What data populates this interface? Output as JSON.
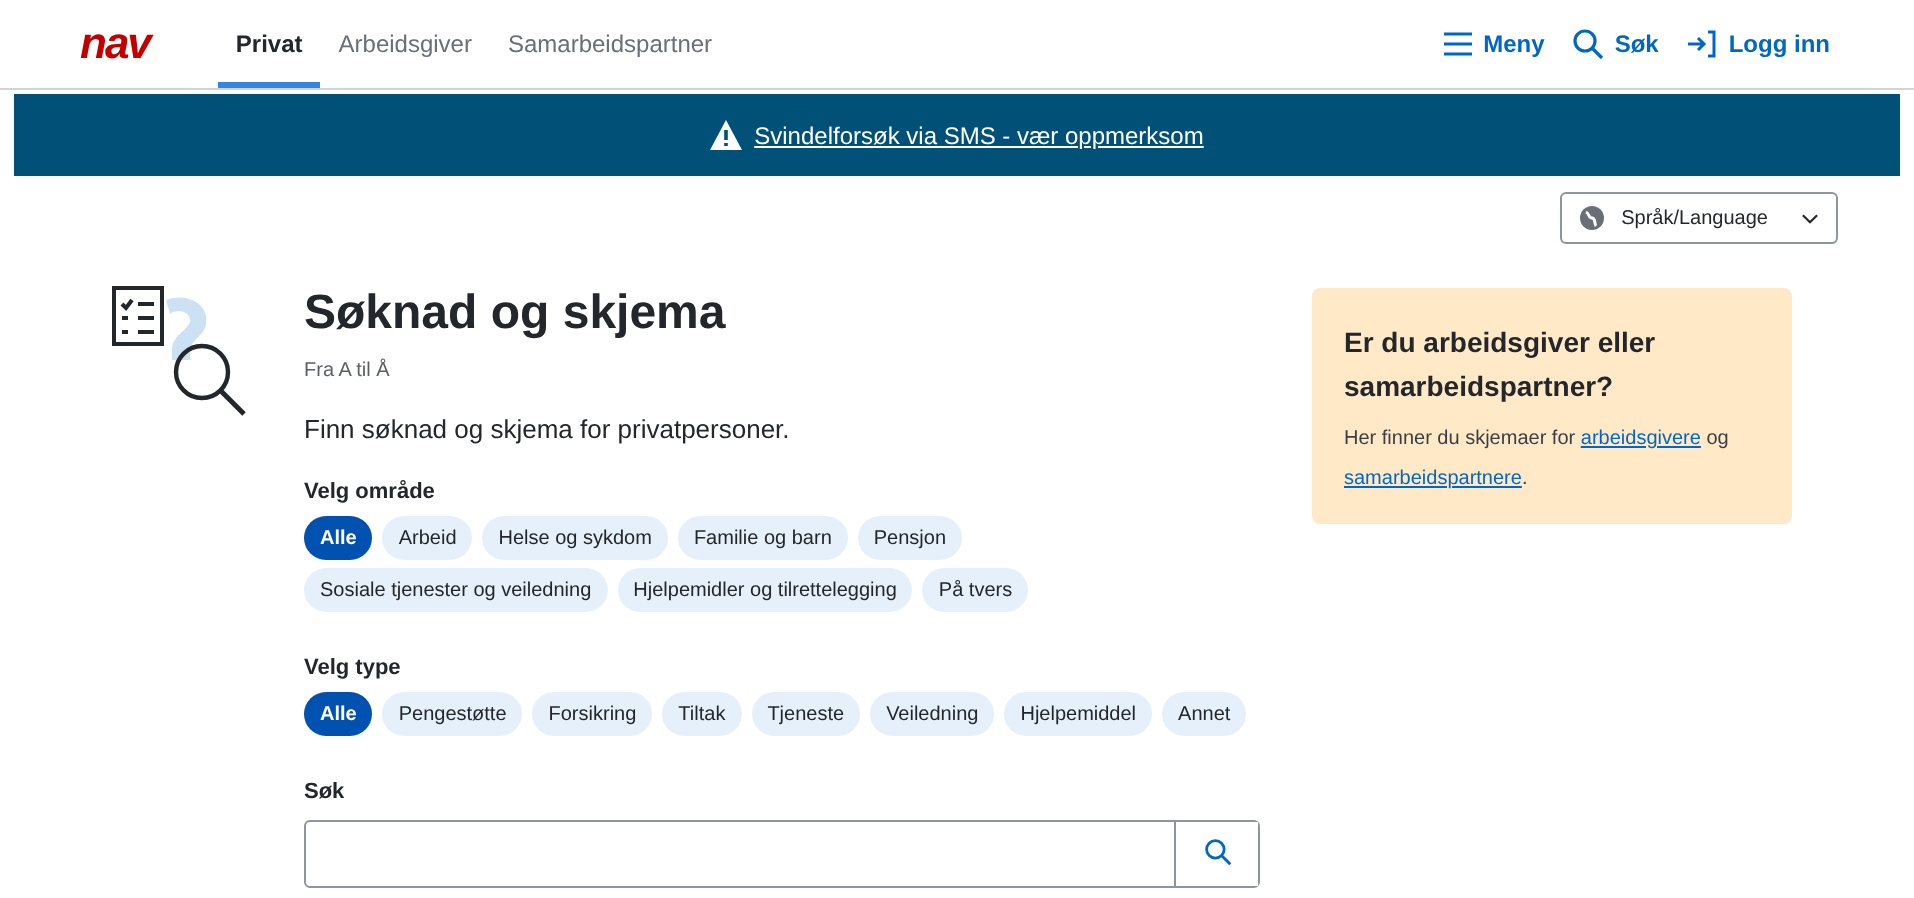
{
  "header": {
    "logo": "nav",
    "tabs": [
      {
        "label": "Privat",
        "selected": true
      },
      {
        "label": "Arbeidsgiver",
        "selected": false
      },
      {
        "label": "Samarbeidspartner",
        "selected": false
      }
    ],
    "actions": [
      {
        "kind": "menu",
        "label": "Meny"
      },
      {
        "kind": "search",
        "label": "Søk"
      },
      {
        "kind": "login",
        "label": "Logg inn"
      }
    ]
  },
  "banner": {
    "text": "Svindelforsøk via SMS - vær oppmerksom"
  },
  "language": {
    "label": "Språk/Language"
  },
  "page": {
    "title": "Søknad og skjema",
    "subtitle": "Fra A til Å",
    "intro": "Finn søknad og skjema for privatpersoner.",
    "area_filter": {
      "label": "Velg område",
      "options": [
        {
          "label": "Alle",
          "selected": true
        },
        {
          "label": "Arbeid",
          "selected": false
        },
        {
          "label": "Helse og sykdom",
          "selected": false
        },
        {
          "label": "Familie og barn",
          "selected": false
        },
        {
          "label": "Pensjon",
          "selected": false
        },
        {
          "label": "Sosiale tjenester og veiledning",
          "selected": false
        },
        {
          "label": "Hjelpemidler og tilrettelegging",
          "selected": false
        },
        {
          "label": "På tvers",
          "selected": false
        }
      ]
    },
    "type_filter": {
      "label": "Velg type",
      "options": [
        {
          "label": "Alle",
          "selected": true
        },
        {
          "label": "Pengestøtte",
          "selected": false
        },
        {
          "label": "Forsikring",
          "selected": false
        },
        {
          "label": "Tiltak",
          "selected": false
        },
        {
          "label": "Tjeneste",
          "selected": false
        },
        {
          "label": "Veiledning",
          "selected": false
        },
        {
          "label": "Hjelpemiddel",
          "selected": false
        },
        {
          "label": "Annet",
          "selected": false
        }
      ]
    },
    "search": {
      "label": "Søk"
    }
  },
  "info_card": {
    "title": "Er du arbeidsgiver eller samarbeidspartner?",
    "text_before": "Her finner du skjemaer for ",
    "link_1": "arbeidsgivere",
    "text_middle": " og ",
    "link_2": "samarbeidspartnere",
    "text_after": "."
  }
}
